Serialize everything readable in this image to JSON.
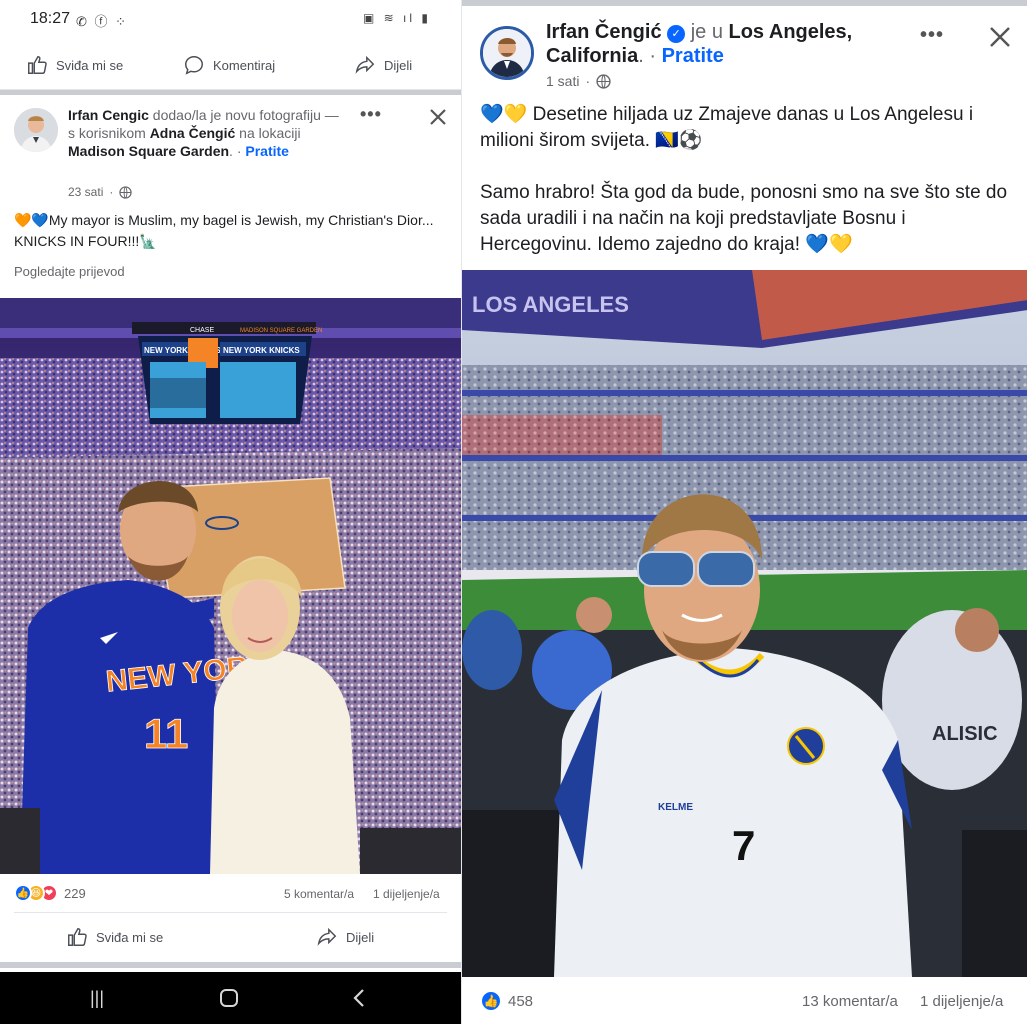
{
  "left": {
    "status": {
      "time": "18:27",
      "app_icons": "✆ ⓕ ⁘",
      "right_icons": "▣ ≋ ıl ▮"
    },
    "top_actions": {
      "like": "Sviđa mi se",
      "comment": "Komentiraj",
      "share": "Dijeli"
    },
    "post": {
      "author": "Irfan Cengic",
      "action_text": " dodao/la je novu fotografiju — s korisnikom ",
      "tagged": "Adna Čengić",
      "location_prefix": " na lokaciji ",
      "location": "Madison Square Garden",
      "follow": "Pratite",
      "time": "23 sati",
      "caption": "🧡💙My mayor is Muslim, my bagel is Jewish, my Christian's Dior... KNICKS IN FOUR!!!🗽",
      "translate": "Pogledajte prijevod",
      "photo": {
        "scoreboard_left": "NEW YORK KNICKS",
        "scoreboard_right": "NEW YORK KNICKS",
        "scoreboard_top": "MADISON SQUARE GARDEN",
        "sponsor": "CHASE",
        "jersey_text": "NEW YORK",
        "jersey_number": "11"
      },
      "reaction_count": "229",
      "comments": "5 komentar/a",
      "shares": "1 dijeljenje/a",
      "like_btn": "Sviđa mi se",
      "share_btn": "Dijeli"
    },
    "colors": {
      "accent": "#0866ff",
      "knicks_orange": "#f58426",
      "knicks_blue": "#1d428a"
    }
  },
  "right": {
    "author": "Irfan Čengić",
    "is_in": " je u ",
    "location": "Los Angeles, California",
    "follow": "Pratite",
    "time": "1 sati",
    "caption_p1": "💙💛 Desetine hiljada uz Zmajeve danas u Los Angelesu i milioni širom svijeta. 🇧🇦⚽",
    "caption_p2": "Samo hrabro! Šta god da bude, ponosni smo na sve što ste do sada uradili i na način na koji predstavljate Bosnu i Hercegovinu. Idemo zajedno do kraja! 💙💛",
    "photo": {
      "stadium_banner": "LOS ANGELES",
      "jersey_number": "7",
      "jersey_brand": "KELME",
      "bg_shirt_text": "ALISIC"
    },
    "reaction_count": "458",
    "comments": "13 komentar/a",
    "shares": "1 dijeljenje/a",
    "colors": {
      "bih_blue": "#1f3f9a",
      "bih_yellow": "#f7c600"
    }
  }
}
